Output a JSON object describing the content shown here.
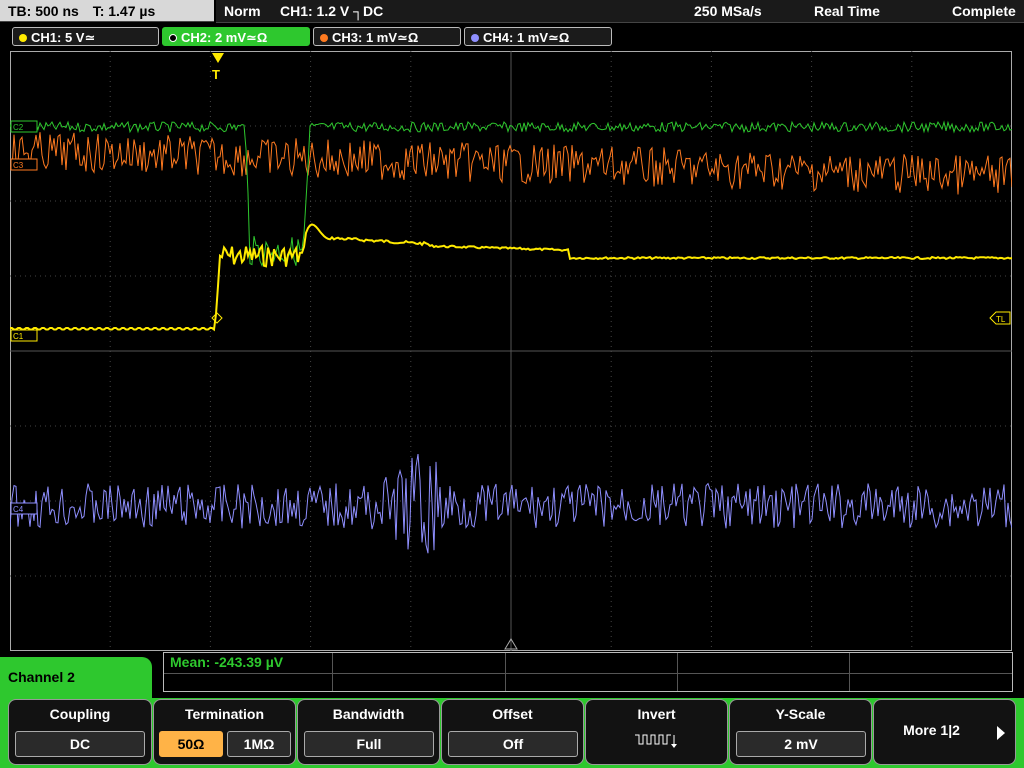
{
  "status": {
    "timebase": "TB: 500 ns",
    "trigger_time": "T: 1.47 µs",
    "mode": "Norm",
    "trigger": "CH1: 1.2 V ┐DC",
    "sample_rate": "250 MSa/s",
    "acq": "Real Time",
    "state": "Complete"
  },
  "channels": [
    {
      "label": "CH1: 5 V≃",
      "color": "#ffea00"
    },
    {
      "label": "CH2: 2 mV≃Ω",
      "color": "#2ec82e"
    },
    {
      "label": "CH3: 1 mV≃Ω",
      "color": "#ff7a20"
    },
    {
      "label": "CH4: 1 mV≃Ω",
      "color": "#8f8fff"
    }
  ],
  "markers": {
    "trigger": "T",
    "c1": "C1",
    "c2": "C2",
    "c3": "C3",
    "c4": "C4",
    "tl": "TL"
  },
  "measurement": {
    "mean": "Mean: -243.39 µV"
  },
  "panel": {
    "channel_label": "Channel 2",
    "coupling_title": "Coupling",
    "coupling_value": "DC",
    "termination_title": "Termination",
    "term_50": "50Ω",
    "term_1m": "1MΩ",
    "bandwidth_title": "Bandwidth",
    "bandwidth_value": "Full",
    "offset_title": "Offset",
    "offset_value": "Off",
    "invert_title": "Invert",
    "yscale_title": "Y-Scale",
    "yscale_value": "2 mV",
    "more_label": "More 1|2"
  },
  "colors": {
    "ch1": "#ffea00",
    "ch2": "#2ec82e",
    "ch3": "#ff7a20",
    "ch4": "#8f8fff",
    "grid": "#555555",
    "accent": "#2ec82e"
  }
}
